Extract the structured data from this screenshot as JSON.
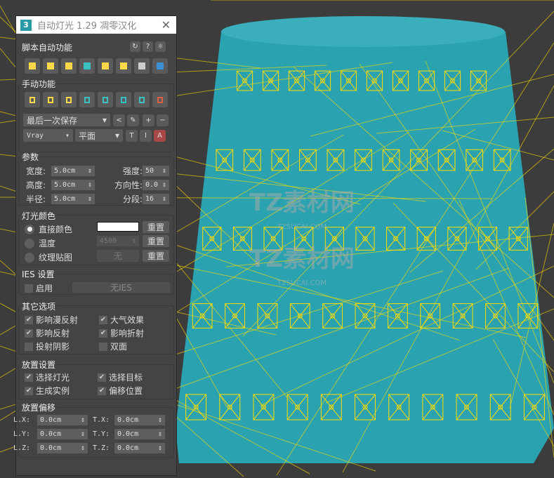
{
  "window": {
    "title": "自动灯光 1.29 凋零汉化",
    "logo": "3"
  },
  "auto": {
    "header": "脚本自动功能",
    "help": "?"
  },
  "manual": {
    "header": "手动功能",
    "preset": "最后一次保存",
    "renderer": "Vray",
    "light_type": "平面",
    "t1": "T",
    "t2": "I",
    "t3": "A",
    "plus": "+",
    "minus": "−",
    "back": "<"
  },
  "params": {
    "header": "参数",
    "width_label": "宽度:",
    "width": "5.0cm",
    "height_label": "高度:",
    "height": "5.0cm",
    "radius_label": "半径:",
    "radius": "5.0cm",
    "intensity_label": "强度:",
    "intensity": "50",
    "direction_label": "方向性:",
    "direction": "0.0",
    "segments_label": "分段:",
    "segments": "16"
  },
  "color": {
    "header": "灯光颜色",
    "direct": "直接颜色",
    "temp": "温度",
    "temp_value": "4500",
    "texture": "纹理贴图",
    "none": "无",
    "reset": "重置",
    "swatch": "#ffffff"
  },
  "ies": {
    "header": "IES 设置",
    "enable": "启用",
    "none": "无IES"
  },
  "other": {
    "header": "其它选项",
    "diffuse": "影响漫反射",
    "atmos": "大气效果",
    "reflect": "影响反射",
    "refract": "影响折射",
    "shadow": "投射阴影",
    "twoside": "双面"
  },
  "place": {
    "header": "放置设置",
    "select_light": "选择灯光",
    "select_target": "选择目标",
    "instance": "生成实例",
    "offset_pos": "偏移位置"
  },
  "offset": {
    "header": "放置偏移",
    "lx": "L.X:",
    "ly": "L.Y:",
    "lz": "L.Z:",
    "tx": "T.X:",
    "ty": "T.Y:",
    "tz": "T.Z:",
    "v": "0.0cm"
  },
  "watermark": {
    "text": "TZ素材网",
    "sub": "TZSUCAI.COM"
  }
}
